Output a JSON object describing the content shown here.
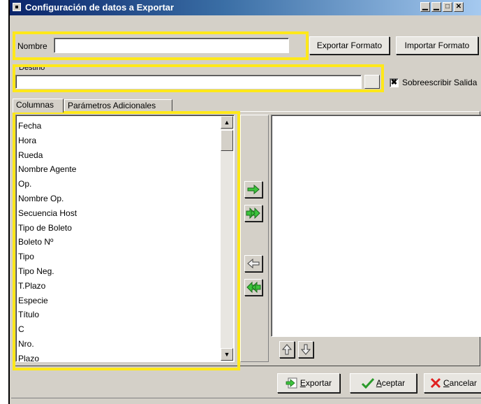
{
  "window": {
    "title": "Configuración de datos a Exportar"
  },
  "form": {
    "nombre_label": "Nombre",
    "nombre_value": "",
    "exportar_formato_label": "Exportar Formato",
    "importar_formato_label": "Importar Formato",
    "destino_label": "Destino",
    "destino_value": "",
    "sobreescribir_label": "Sobreescribir Salida",
    "sobreescribir_checked": "✖"
  },
  "tabs": [
    {
      "label": "Columnas"
    },
    {
      "label": "Parámetros Adicionales"
    }
  ],
  "columns": {
    "available": [
      "Fecha",
      "Hora",
      "Rueda",
      "Nombre Agente",
      "Op.",
      "Nombre Op.",
      "Secuencia Host",
      "Tipo de Boleto",
      "Boleto Nº",
      "Tipo",
      "Tipo Neg.",
      "T.Plazo",
      "Especie",
      "Título",
      "C",
      "Nro.",
      "Plazo"
    ],
    "selected": []
  },
  "footer": {
    "exportar_prefix": "E",
    "exportar_rest": "xportar",
    "aceptar_prefix": "A",
    "aceptar_rest": "ceptar",
    "cancelar_prefix": "C",
    "cancelar_rest": "ancelar"
  },
  "icons": {
    "move_right": "arrow-right-icon",
    "move_all_right": "double-arrow-right-icon",
    "move_left": "arrow-left-icon",
    "move_all_left": "double-arrow-left-icon",
    "move_up": "arrow-up-icon",
    "move_down": "arrow-down-icon"
  },
  "colors": {
    "highlight": "#ffe81a",
    "titlebar": "#0a246a",
    "arrow_green": "#3cc43c"
  }
}
